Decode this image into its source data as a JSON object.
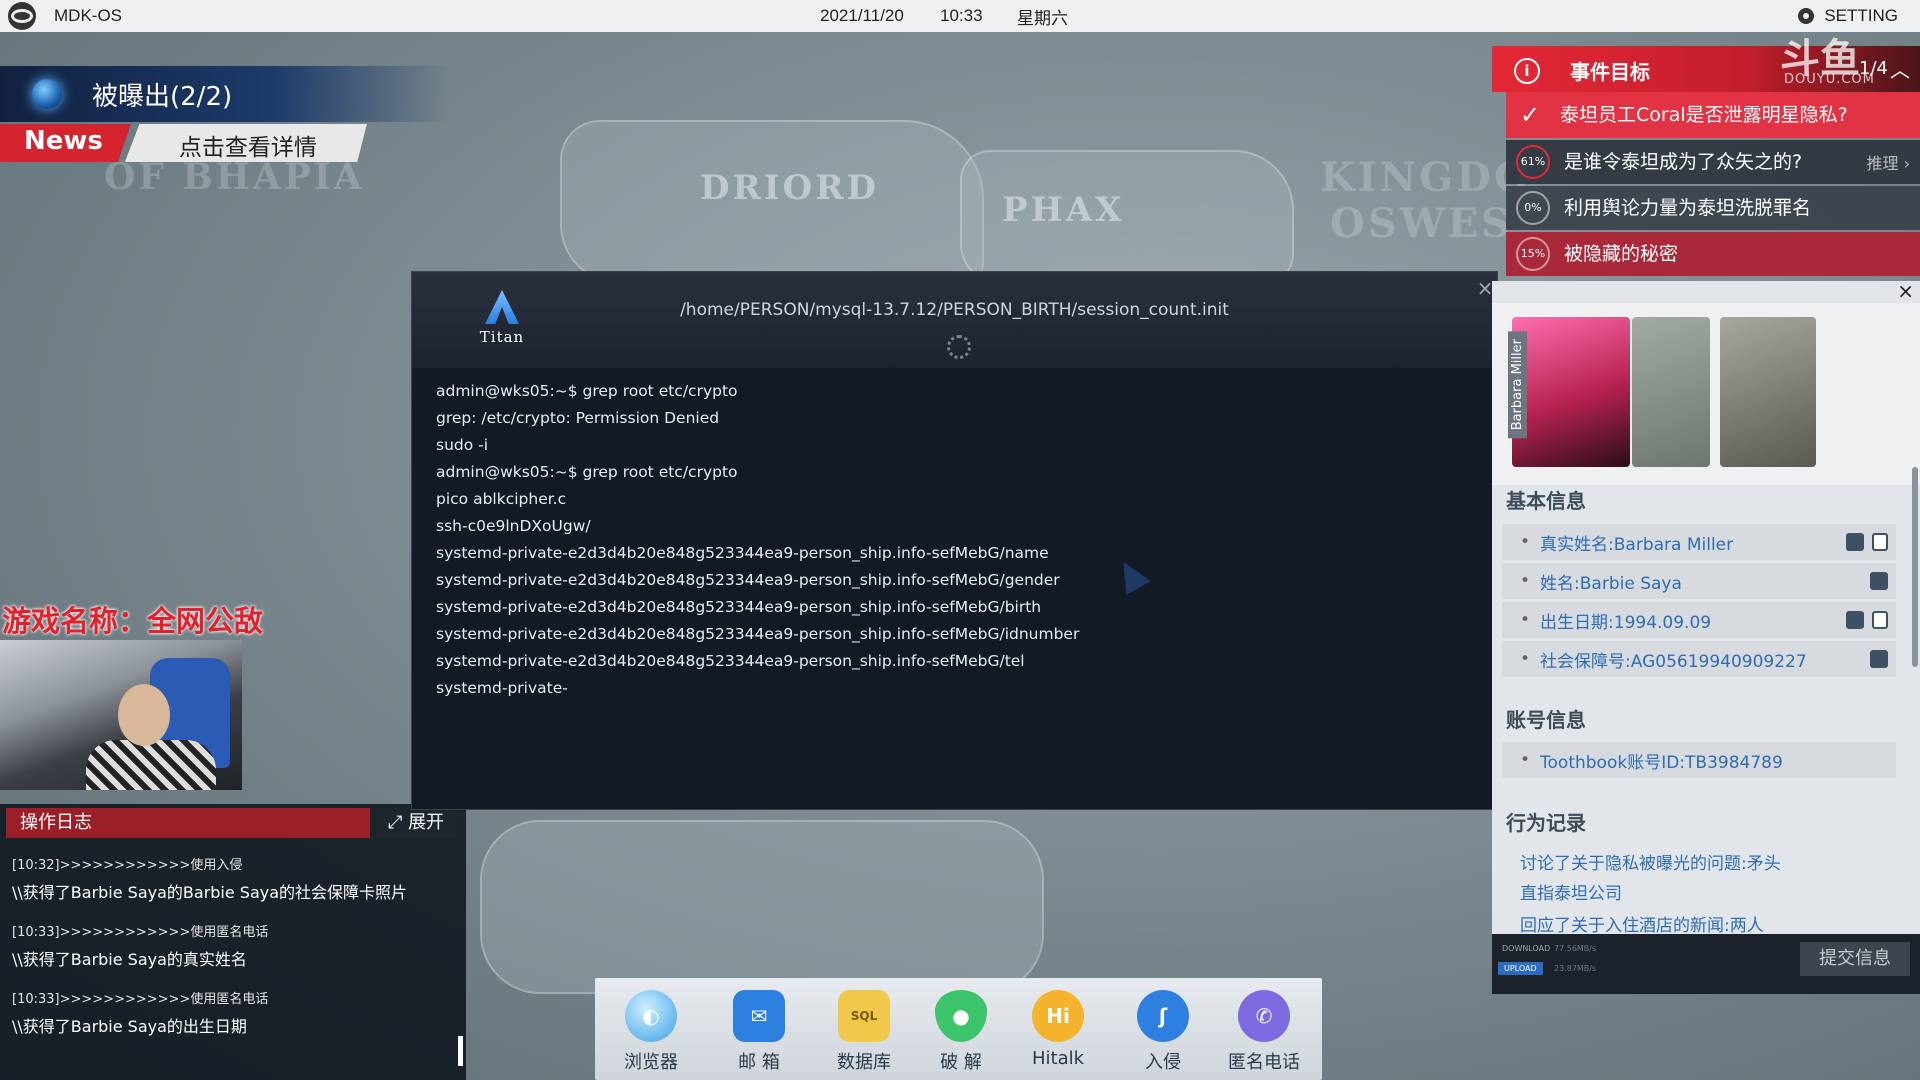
{
  "topbar": {
    "app_name": "MDK-OS",
    "date": "2021/11/20",
    "time": "10:33",
    "weekday": "星期六",
    "setting_label": "SETTING"
  },
  "map": {
    "labels": [
      "DRIORD",
      "PHAX",
      "OF BHAPIA",
      "KINGDO",
      "OSWES"
    ]
  },
  "news": {
    "title": "被曝出(2/2)",
    "tag": "News",
    "link": "点击查看详情"
  },
  "overlay": {
    "game_name": "游戏名称：全网公敌"
  },
  "log": {
    "header": "操作日志",
    "expand": "展开",
    "entries": [
      {
        "time": "[10:32]>>>>>>>>>>>>使用入侵",
        "text": "\\\\获得了Barbie Saya的Barbie Saya的社会保障卡照片"
      },
      {
        "time": "[10:33]>>>>>>>>>>>>使用匿名电话",
        "text": "\\\\获得了Barbie Saya的真实姓名"
      },
      {
        "time": "[10:33]>>>>>>>>>>>>使用匿名电话",
        "text": "\\\\获得了Barbie Saya的出生日期"
      }
    ]
  },
  "terminal": {
    "brand": "Titan",
    "path": "/home/PERSON/mysql-13.7.12/PERSON_BIRTH/session_count.init",
    "lines": [
      "admin@wks05:~$ grep root etc/crypto",
      "grep: /etc/crypto: Permission Denied",
      "sudo -i",
      "admin@wks05:~$ grep root etc/crypto",
      "pico ablkcipher.c",
      "ssh-c0e9lnDXoUgw/",
      "systemd-private-e2d3d4b20e848g523344ea9-person_ship.info-sefMebG/name",
      "systemd-private-e2d3d4b20e848g523344ea9-person_ship.info-sefMebG/gender",
      "systemd-private-e2d3d4b20e848g523344ea9-person_ship.info-sefMebG/birth",
      "systemd-private-e2d3d4b20e848g523344ea9-person_ship.info-sefMebG/idnumber",
      "systemd-private-e2d3d4b20e848g523344ea9-person_ship.info-sefMebG/tel",
      "systemd-private-"
    ]
  },
  "goals": {
    "title": "事件目标",
    "count": "1/4",
    "watermark": "斗鱼",
    "watermark_sub": "DOUYU.COM",
    "items": [
      {
        "progress": "",
        "text": "泰坦员工Coral是否泄露明星隐私?",
        "hint": "",
        "done": true
      },
      {
        "progress": "61%",
        "text": "是谁令泰坦成为了众矢之的?",
        "hint": "推理 ›",
        "done": false
      },
      {
        "progress": "0%",
        "text": "利用舆论力量为泰坦洗脱罪名",
        "hint": "",
        "done": false
      },
      {
        "progress": "15%",
        "text": "被隐藏的秘密",
        "hint": "",
        "done": false
      }
    ],
    "colors": {
      "active": "#e32837",
      "done": "#e23344"
    }
  },
  "profile": {
    "portrait_name": "Barbara Miller",
    "basic_title": "基本信息",
    "basic": [
      {
        "text": "真实姓名:Barbara Miller"
      },
      {
        "text": "姓名:Barbie Saya"
      },
      {
        "text": "出生日期:1994.09.09"
      },
      {
        "text": "社会保障号:AG05619940909227"
      }
    ],
    "account_title": "账号信息",
    "account": [
      {
        "text": "Toothbook账号ID:TB3984789"
      }
    ],
    "behavior_title": "行为记录",
    "behavior": [
      "讨论了关于隐私被曝光的问题:矛头直指泰坦公司",
      "回应了关于入住酒店的新闻:两人"
    ],
    "download_label": "DOWNLOAD",
    "download_value": "77.56MB/s",
    "upload_label": "UPLOAD",
    "upload_value": "23.87MB/s",
    "submit": "提交信息"
  },
  "dock": {
    "items": [
      {
        "label": "浏览器",
        "icon": "browser-icon"
      },
      {
        "label": "邮 箱",
        "icon": "mail-icon"
      },
      {
        "label": "数据库",
        "icon": "database-icon"
      },
      {
        "label": "破 解",
        "icon": "crack-icon"
      },
      {
        "label": "Hitalk",
        "icon": "hitalk-icon"
      },
      {
        "label": "入侵",
        "icon": "hook-icon"
      },
      {
        "label": "匿名电话",
        "icon": "phone-icon"
      }
    ]
  }
}
